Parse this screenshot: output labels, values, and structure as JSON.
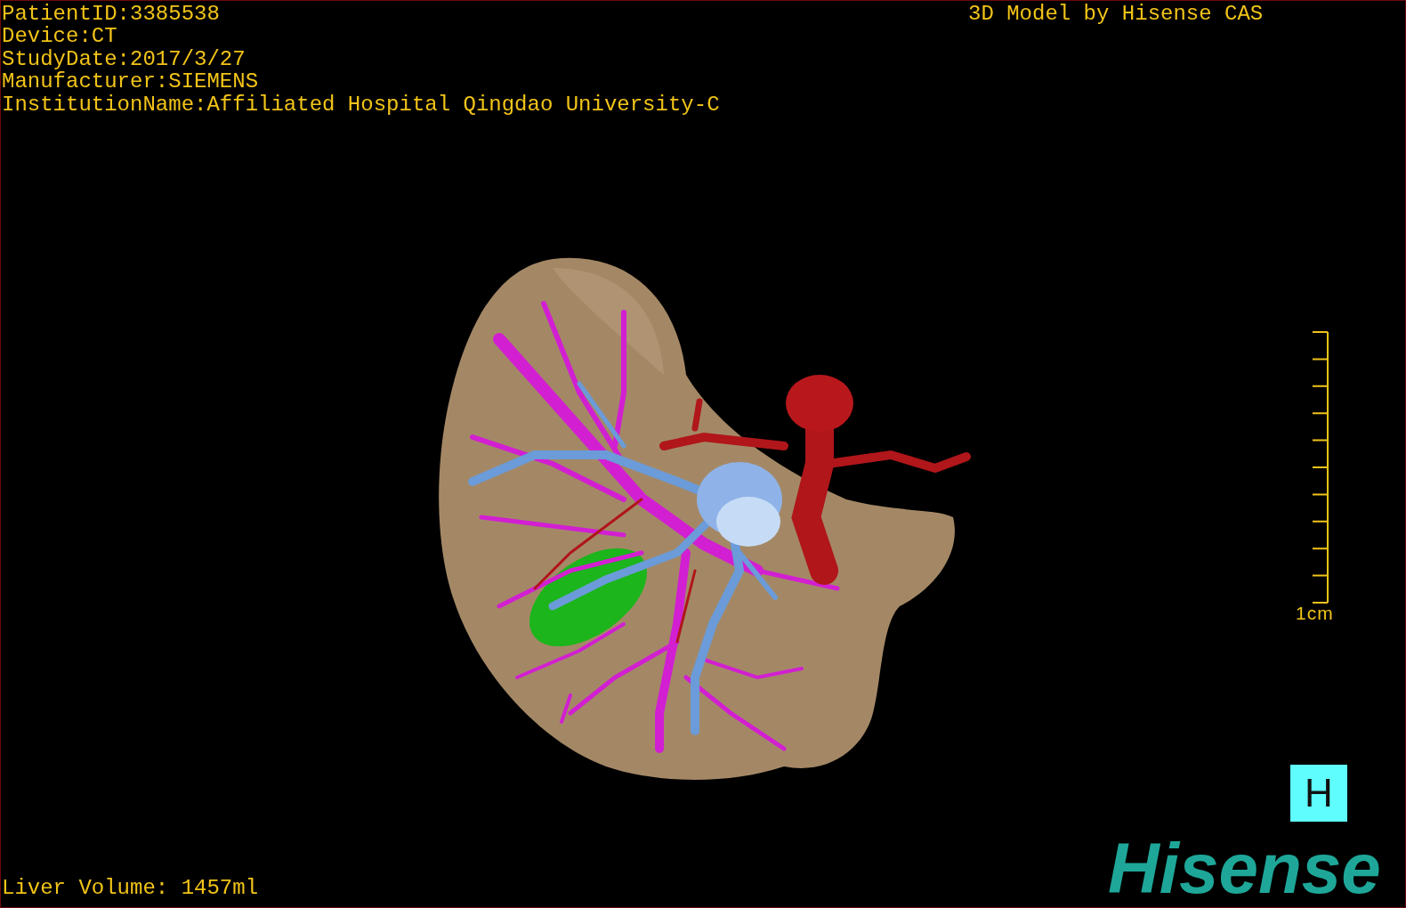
{
  "info_lines": [
    "PatientID:3385538",
    "Device:CT",
    "StudyDate:2017/3/27",
    "Manufacturer:SIEMENS",
    "InstitutionName:Affiliated Hospital Qingdao University-C"
  ],
  "title": "3D Model by Hisense CAS",
  "scale_bar": {
    "label": "1cm"
  },
  "orientation_marker": "H",
  "liver_volume": "Liver Volume: 1457ml",
  "logo": "Hisense"
}
